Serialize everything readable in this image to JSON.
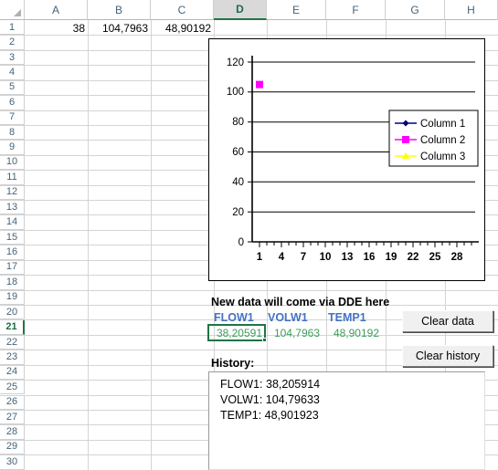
{
  "grid": {
    "columns": [
      {
        "label": "A",
        "selected": false
      },
      {
        "label": "B",
        "selected": false
      },
      {
        "label": "C",
        "selected": false
      },
      {
        "label": "D",
        "selected": true
      },
      {
        "label": "E",
        "selected": false
      },
      {
        "label": "F",
        "selected": false
      },
      {
        "label": "G",
        "selected": false
      },
      {
        "label": "H",
        "selected": false
      }
    ],
    "rows": [
      "1",
      "2",
      "3",
      "4",
      "5",
      "6",
      "7",
      "8",
      "9",
      "10",
      "11",
      "12",
      "13",
      "14",
      "15",
      "16",
      "17",
      "18",
      "19",
      "20",
      "21",
      "22",
      "23",
      "24",
      "25",
      "26",
      "27",
      "28",
      "29",
      "30"
    ],
    "selected_row": "21",
    "active_cell": "D21"
  },
  "cells": {
    "a1": "38",
    "b1": "104,7963",
    "c1": "48,90192",
    "note": "New data will come via DDE here",
    "flow_label": "FLOW1",
    "volw_label": "VOLW1",
    "temp_label": "TEMP1",
    "flow_value": "38,20591",
    "volw_value": "104,7963",
    "temp_value": "48,90192",
    "history_label": "History:"
  },
  "buttons": {
    "clear_data": "Clear data",
    "clear_history": "Clear history"
  },
  "history": {
    "lines": [
      "FLOW1: 38,205914",
      "VOLW1: 104,79633",
      "TEMP1: 48,901923"
    ]
  },
  "chart_data": {
    "type": "scatter",
    "title": "",
    "xlabel": "",
    "ylabel": "",
    "xlim": [
      0,
      31
    ],
    "ylim": [
      0,
      120
    ],
    "ytick_values": [
      0,
      20,
      40,
      60,
      80,
      100,
      120
    ],
    "ytick_labels": [
      "0",
      "20",
      "40",
      "60",
      "80",
      "100",
      "120"
    ],
    "xtick_labels": [
      "1",
      "4",
      "7",
      "10",
      "13",
      "16",
      "19",
      "22",
      "25",
      "28"
    ],
    "xtick_values": [
      1,
      4,
      7,
      10,
      13,
      16,
      19,
      22,
      25,
      28
    ],
    "grid": "horizontal",
    "legend_position": "inside-right",
    "series": [
      {
        "name": "Column 1",
        "color": "#000080",
        "marker": "diamond",
        "x": [],
        "values": []
      },
      {
        "name": "Column 2",
        "color": "#ff00ff",
        "marker": "square",
        "x": [
          1
        ],
        "values": [
          105
        ]
      },
      {
        "name": "Column 3",
        "color": "#ffff00",
        "marker": "triangle",
        "x": [],
        "values": []
      }
    ]
  },
  "colors": {
    "header_text": "#45637a",
    "selection_green": "#217346",
    "value_green": "#3f9e5c",
    "label_blue": "#4472c4"
  }
}
